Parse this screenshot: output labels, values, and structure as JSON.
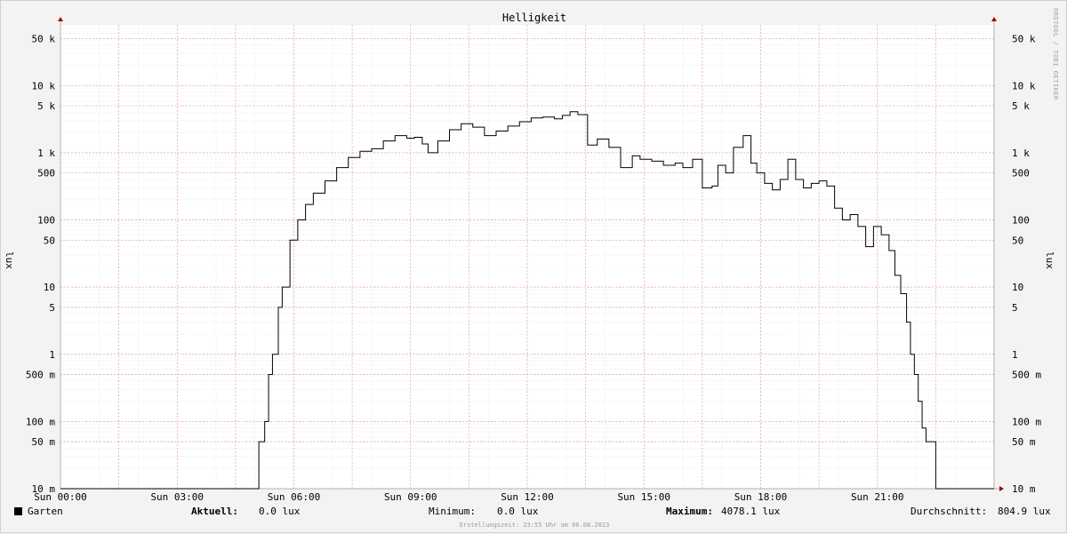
{
  "chart_data": {
    "type": "line",
    "title": "Helligkeit",
    "ylabel_left": "lux",
    "ylabel_right": "lux",
    "yscale": "log",
    "ylim": [
      0.01,
      80000
    ],
    "xlim_hours": [
      0,
      24
    ],
    "x_ticks": [
      "Sun 00:00",
      "Sun 03:00",
      "Sun 06:00",
      "Sun 09:00",
      "Sun 12:00",
      "Sun 15:00",
      "Sun 18:00",
      "Sun 21:00"
    ],
    "y_ticks": [
      {
        "value": 0.01,
        "label": "10 m"
      },
      {
        "value": 0.05,
        "label": "50 m"
      },
      {
        "value": 0.1,
        "label": "100 m"
      },
      {
        "value": 0.5,
        "label": "500 m"
      },
      {
        "value": 1,
        "label": "1"
      },
      {
        "value": 5,
        "label": "5"
      },
      {
        "value": 10,
        "label": "10"
      },
      {
        "value": 50,
        "label": "50"
      },
      {
        "value": 100,
        "label": "100"
      },
      {
        "value": 500,
        "label": "500"
      },
      {
        "value": 1000,
        "label": "1 k"
      },
      {
        "value": 5000,
        "label": "5 k"
      },
      {
        "value": 10000,
        "label": "10 k"
      },
      {
        "value": 50000,
        "label": "50 k"
      }
    ],
    "series": [
      {
        "name": "Garten",
        "color": "#000000",
        "points": [
          [
            0,
            0.01
          ],
          [
            5.05,
            0.01
          ],
          [
            5.1,
            0.05
          ],
          [
            5.25,
            0.1
          ],
          [
            5.35,
            0.5
          ],
          [
            5.45,
            1
          ],
          [
            5.6,
            5
          ],
          [
            5.7,
            10
          ],
          [
            5.9,
            50
          ],
          [
            6.1,
            100
          ],
          [
            6.3,
            170
          ],
          [
            6.5,
            250
          ],
          [
            6.8,
            380
          ],
          [
            7.1,
            600
          ],
          [
            7.4,
            850
          ],
          [
            7.7,
            1050
          ],
          [
            8.0,
            1150
          ],
          [
            8.3,
            1500
          ],
          [
            8.6,
            1800
          ],
          [
            8.9,
            1650
          ],
          [
            9.1,
            1700
          ],
          [
            9.3,
            1350
          ],
          [
            9.45,
            1000
          ],
          [
            9.7,
            1500
          ],
          [
            10.0,
            2200
          ],
          [
            10.3,
            2700
          ],
          [
            10.6,
            2400
          ],
          [
            10.9,
            1800
          ],
          [
            11.2,
            2100
          ],
          [
            11.5,
            2500
          ],
          [
            11.8,
            2900
          ],
          [
            12.1,
            3300
          ],
          [
            12.4,
            3400
          ],
          [
            12.7,
            3200
          ],
          [
            12.9,
            3600
          ],
          [
            13.1,
            4078.1
          ],
          [
            13.3,
            3700
          ],
          [
            13.55,
            1300
          ],
          [
            13.8,
            1600
          ],
          [
            14.1,
            1200
          ],
          [
            14.4,
            600
          ],
          [
            14.7,
            900
          ],
          [
            14.9,
            800
          ],
          [
            15.2,
            750
          ],
          [
            15.5,
            650
          ],
          [
            15.8,
            700
          ],
          [
            16.0,
            600
          ],
          [
            16.25,
            800
          ],
          [
            16.5,
            300
          ],
          [
            16.75,
            320
          ],
          [
            16.9,
            650
          ],
          [
            17.1,
            500
          ],
          [
            17.3,
            1200
          ],
          [
            17.55,
            1800
          ],
          [
            17.75,
            700
          ],
          [
            17.9,
            500
          ],
          [
            18.1,
            350
          ],
          [
            18.3,
            280
          ],
          [
            18.5,
            400
          ],
          [
            18.7,
            800
          ],
          [
            18.9,
            400
          ],
          [
            19.1,
            300
          ],
          [
            19.3,
            350
          ],
          [
            19.5,
            380
          ],
          [
            19.7,
            320
          ],
          [
            19.9,
            150
          ],
          [
            20.1,
            100
          ],
          [
            20.3,
            120
          ],
          [
            20.5,
            80
          ],
          [
            20.7,
            40
          ],
          [
            20.9,
            80
          ],
          [
            21.1,
            60
          ],
          [
            21.3,
            35
          ],
          [
            21.45,
            15
          ],
          [
            21.6,
            8
          ],
          [
            21.75,
            3
          ],
          [
            21.85,
            1
          ],
          [
            21.95,
            0.5
          ],
          [
            22.05,
            0.2
          ],
          [
            22.15,
            0.08
          ],
          [
            22.25,
            0.05
          ],
          [
            22.45,
            0.05
          ],
          [
            22.5,
            0.01
          ],
          [
            24,
            0.01
          ]
        ]
      }
    ],
    "legend": {
      "series_name": "Garten",
      "aktuell_label": "Aktuell:",
      "aktuell_value": "0.0 lux",
      "minimum_label": "Minimum:",
      "minimum_value": "0.0 lux",
      "maximum_label": "Maximum:",
      "maximum_value": "4078.1 lux",
      "average_label": "Durchschnitt:",
      "average_value": "804.9 lux"
    },
    "footer": "Erstellungszeit: 23:55 Uhr am 06.08.2023",
    "watermark": "RRDTOOL / TOBI OETIKER",
    "colors": {
      "background": "#f3f3f3",
      "canvas": "#ffffff",
      "major_grid": "#e8a0a0",
      "minor_grid": "#dddddd",
      "axis": "#b0b0b0",
      "arrow": "#a00000",
      "line": "#000000"
    }
  }
}
